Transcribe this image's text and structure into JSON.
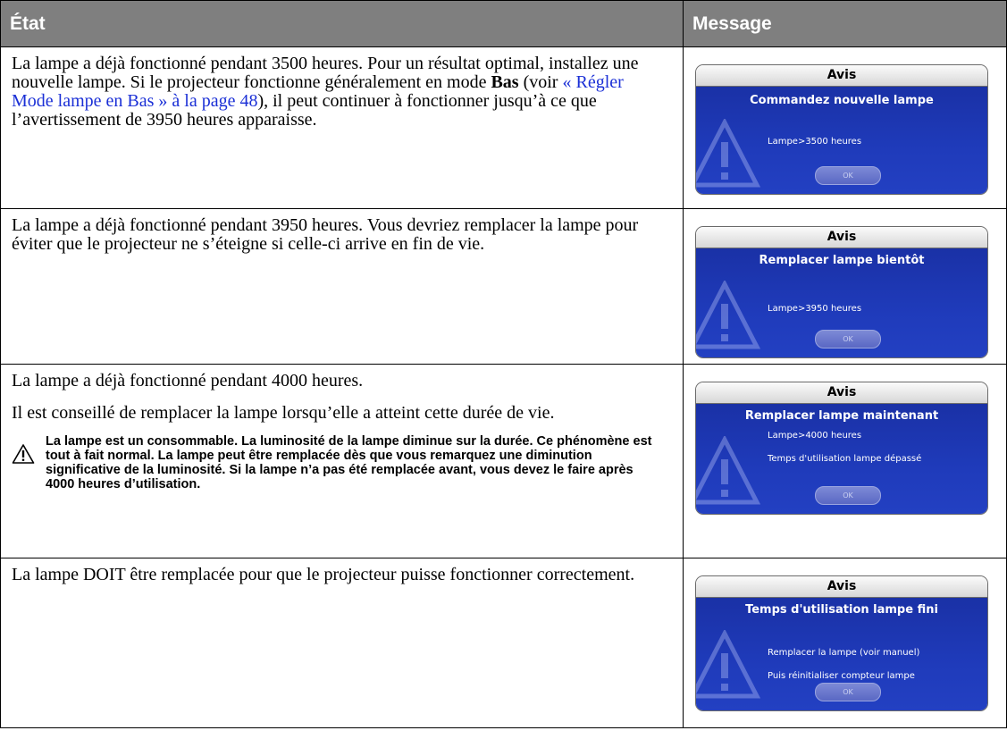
{
  "table": {
    "header_state": "État",
    "header_message": "Message"
  },
  "rows": [
    {
      "state_text_1": "La lampe a déjà fonctionné pendant 3500 heures. Pour un résultat optimal, installez une nouvelle lampe. Si le projecteur fonctionne généralement en mode ",
      "state_bold": "Bas",
      "state_text_2": " (voir ",
      "state_link_1": "« Régler Mode lampe en Bas » à la page 48",
      "state_text_3": "), il peut continuer à fonctionner jusqu’à ce que l’avertissement de 3950 heures apparaisse.",
      "dialog": {
        "title": "Avis",
        "heading": "Commandez nouvelle lampe",
        "line1": "Lampe>3500 heures",
        "ok": "OK"
      }
    },
    {
      "state_text_1": "La lampe a déjà fonctionné pendant 3950 heures. Vous devriez remplacer la lampe pour éviter que le projecteur ne s’éteigne si celle-ci arrive en fin de vie.",
      "dialog": {
        "title": "Avis",
        "heading": "Remplacer lampe bientôt",
        "line1": "Lampe>3950 heures",
        "ok": "OK"
      }
    },
    {
      "state_text_1": "La lampe a déjà fonctionné pendant 4000 heures.",
      "state_text_2": "Il est conseillé de remplacer la lampe lorsqu’elle a atteint cette durée de vie.",
      "note": "La lampe est un consommable. La luminosité de la lampe diminue sur la durée. Ce phénomène est tout à fait normal. La lampe peut être remplacée dès que vous remarquez une diminution significative de la luminosité. Si la lampe n’a pas été remplacée avant, vous devez le faire après 4000 heures d’utilisation.",
      "dialog": {
        "title": "Avis",
        "heading": "Remplacer lampe maintenant",
        "line1": "Lampe>4000 heures",
        "line2": "Temps d'utilisation lampe dépassé",
        "ok": "OK"
      }
    },
    {
      "state_text_1": "La lampe DOIT être remplacée pour que le projecteur puisse fonctionner correctement.",
      "dialog": {
        "title": "Avis",
        "heading": "Temps d'utilisation lampe fini",
        "line1": "Remplacer la lampe (voir manuel)",
        "line2": "Puis réinitialiser compteur lampe",
        "ok": "OK"
      }
    }
  ],
  "colors": {
    "header_bg": "#7f7f7f",
    "link": "#1a2fd6",
    "dialog_blue": "#1f3bbb"
  }
}
